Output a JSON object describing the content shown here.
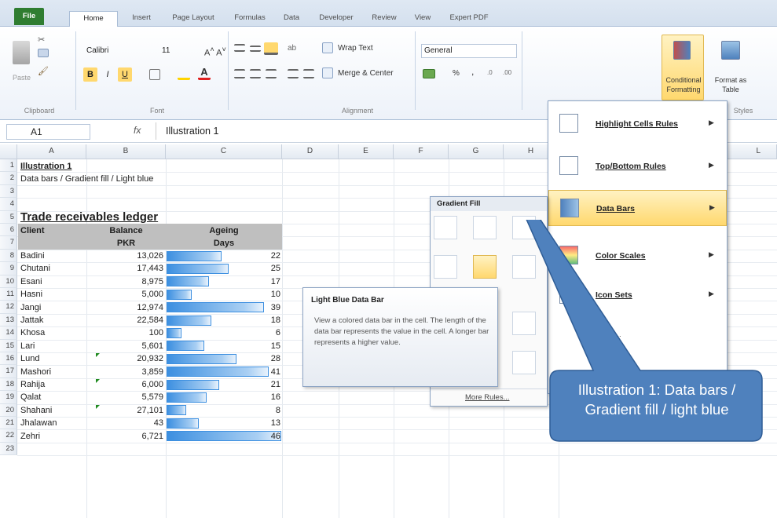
{
  "ribbon": {
    "tabs": [
      "File",
      "Home",
      "Insert",
      "Page Layout",
      "Formulas",
      "Data",
      "Developer",
      "Review",
      "View",
      "Expert PDF"
    ],
    "clipboard": {
      "paste": "Paste",
      "group": "Clipboard"
    },
    "font": {
      "name": "Calibri",
      "size": "11",
      "group": "Font",
      "bold": "B",
      "italic": "I",
      "underline": "U"
    },
    "alignment": {
      "wrap": "Wrap Text",
      "merge": "Merge & Center",
      "group": "Alignment"
    },
    "number": {
      "format": "General",
      "percent": "%",
      "comma": ","
    },
    "styles": {
      "conditional_line1": "Conditional",
      "conditional_line2": "Formatting",
      "format_as_line1": "Format as",
      "format_as_line2": "Table",
      "group": "Styles"
    }
  },
  "formula_bar": {
    "name_box": "A1",
    "fx": "fx",
    "value": "Illustration 1"
  },
  "columns": [
    "A",
    "B",
    "C",
    "D",
    "E",
    "F",
    "G",
    "H",
    "L"
  ],
  "rows": [
    "1",
    "2",
    "3",
    "4",
    "5",
    "6",
    "7",
    "8",
    "9",
    "10",
    "11",
    "12",
    "13",
    "14",
    "15",
    "16",
    "17",
    "18",
    "19",
    "20",
    "21",
    "22",
    "23"
  ],
  "sheet": {
    "title": "Illustration 1",
    "subtitle": "Data bars / Gradient fill / Light blue",
    "heading": "Trade receivables ledger",
    "headers": {
      "client": "Client",
      "balance": "Balance",
      "balance_unit": "PKR",
      "ageing": "Ageing",
      "ageing_unit": "Days"
    },
    "ledger": [
      {
        "client": "Badini",
        "balance": "13,026",
        "days": "22"
      },
      {
        "client": "Chutani",
        "balance": "17,443",
        "days": "25"
      },
      {
        "client": "Esani",
        "balance": "8,975",
        "days": "17"
      },
      {
        "client": "Hasni",
        "balance": "5,000",
        "days": "10"
      },
      {
        "client": "Jangi",
        "balance": "12,974",
        "days": "39"
      },
      {
        "client": "Jattak",
        "balance": "22,584",
        "days": "18"
      },
      {
        "client": "Khosa",
        "balance": "100",
        "days": "6"
      },
      {
        "client": "Lari",
        "balance": "5,601",
        "days": "15"
      },
      {
        "client": "Lund",
        "balance": "20,932",
        "days": "28"
      },
      {
        "client": "Mashori",
        "balance": "3,859",
        "days": "41"
      },
      {
        "client": "Rahija",
        "balance": "6,000",
        "days": "21"
      },
      {
        "client": "Qalat",
        "balance": "5,579",
        "days": "16"
      },
      {
        "client": "Shahani",
        "balance": "27,101",
        "days": "8"
      },
      {
        "client": "Jhalawan",
        "balance": "43",
        "days": "13"
      },
      {
        "client": "Zehri",
        "balance": "6,721",
        "days": "46"
      }
    ]
  },
  "cf_menu": {
    "items": [
      "Highlight Cells Rules",
      "Top/Bottom Rules",
      "Data Bars",
      "Color Scales",
      "Icon Sets"
    ],
    "partial": [
      "ule..."
    ]
  },
  "gradient_panel": {
    "title": "Gradient Fill",
    "more": "More Rules..."
  },
  "tooltip": {
    "title": "Light Blue Data Bar",
    "body": "View a colored data bar in the cell. The length of the data bar represents the value in the cell. A longer bar represents a higher value."
  },
  "callout": {
    "text": "Illustration 1: Data bars / Gradient fill / light blue"
  },
  "colors": {
    "bar": "#3c8fe0",
    "callout": "#4f81bd",
    "file_tab": "#2f7d31",
    "highlight": "#ffd86e"
  }
}
